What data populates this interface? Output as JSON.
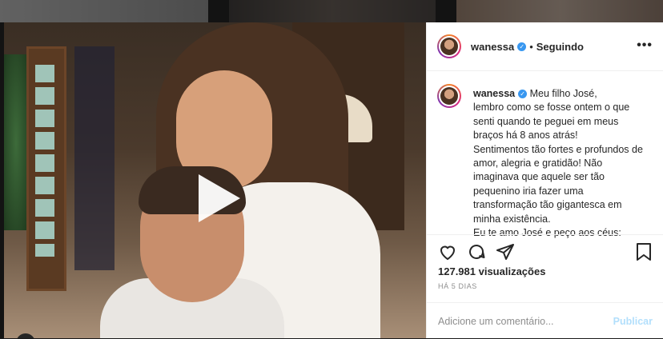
{
  "post": {
    "username": "wanessa",
    "follow_status": "Seguindo",
    "separator": "•",
    "more_label": "•••",
    "caption_lines": [
      "Meu filho José,",
      "lembro como se fosse ontem o que",
      "senti quando te peguei em meus",
      "braços há 8 anos atrás!",
      "Sentimentos tão fortes e profundos de",
      "amor, alegria e gratidão! Não",
      "imaginava que aquele ser tão",
      "pequenino iria fazer uma",
      "transformação tão gigantesca em",
      "minha existência.",
      "Eu te amo José e peço aos céus:"
    ],
    "views": "127.981 visualizações",
    "time_ago": "HÁ 5 DIAS",
    "comment_placeholder": "Adicione um comentário...",
    "publish_label": "Publicar"
  },
  "colors": {
    "verified": "#3897f0",
    "publish_disabled": "#b2dffc",
    "muted": "#8e8e8e"
  },
  "icons": [
    "verified-badge-icon",
    "more-options-icon",
    "heart-icon",
    "comment-icon",
    "share-icon",
    "bookmark-icon",
    "play-icon",
    "user-tag-icon"
  ]
}
